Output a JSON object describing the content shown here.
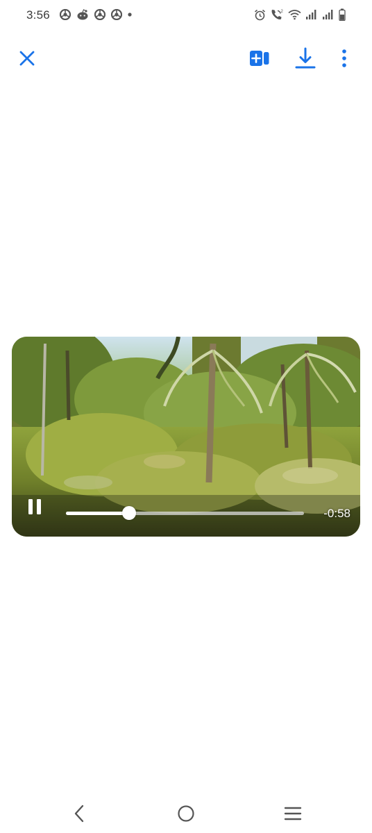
{
  "status_bar": {
    "time": "3:56",
    "left_icons": [
      "chrome-icon",
      "reddit-icon",
      "chrome-icon",
      "chrome-icon",
      "dot-icon"
    ],
    "right_icons": [
      "alarm-icon",
      "wifi-calling-icon",
      "wifi-icon",
      "signal-icon",
      "signal-icon",
      "battery-icon"
    ]
  },
  "toolbar": {
    "accent_color": "#1a73e8",
    "buttons": [
      "close-icon",
      "add-to-album-icon",
      "download-icon",
      "more-vert-icon"
    ]
  },
  "video": {
    "state": "playing",
    "progress": 0.265,
    "time_remaining": "-0:58"
  },
  "nav_bar": {
    "buttons": [
      "back-icon",
      "home-icon",
      "recents-icon"
    ]
  }
}
